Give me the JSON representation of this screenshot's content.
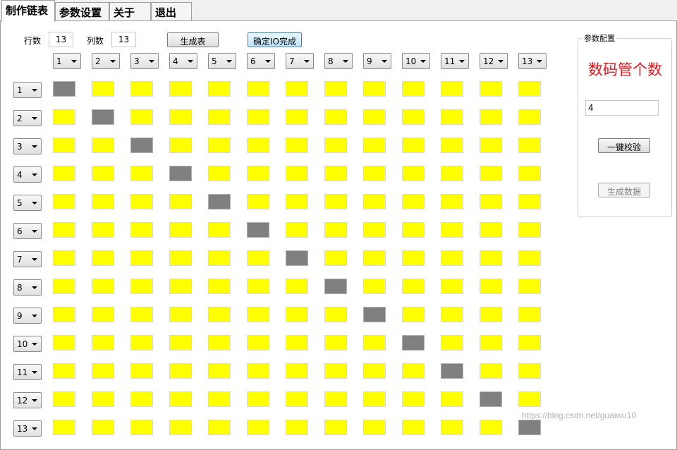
{
  "tabs": [
    {
      "label": "制作链表",
      "active": true
    },
    {
      "label": "参数设置",
      "active": false
    },
    {
      "label": "关于",
      "active": false
    },
    {
      "label": "退出",
      "active": false
    }
  ],
  "toolbar": {
    "rows_label": "行数",
    "rows_value": "13",
    "cols_label": "列数",
    "cols_value": "13",
    "generate_table_label": "生成表",
    "confirm_io_label": "确定IO完成"
  },
  "column_selects": [
    "1",
    "2",
    "3",
    "4",
    "5",
    "6",
    "7",
    "8",
    "9",
    "10",
    "11",
    "12",
    "13"
  ],
  "row_selects": [
    "1",
    "2",
    "3",
    "4",
    "5",
    "6",
    "7",
    "8",
    "9",
    "10",
    "11",
    "12",
    "13"
  ],
  "grid": {
    "rows": 13,
    "cols": 13,
    "on_color": "#ffff00",
    "off_color": "#808080",
    "off_cells": "diagonal"
  },
  "param_panel": {
    "title": "参数配置",
    "digit_count_label": "数码管个数",
    "digit_count_value": "4",
    "verify_button_label": "一键校验",
    "generate_data_label": "生成数据"
  },
  "watermark": "https://blog.csdn.net/guaiwu10"
}
